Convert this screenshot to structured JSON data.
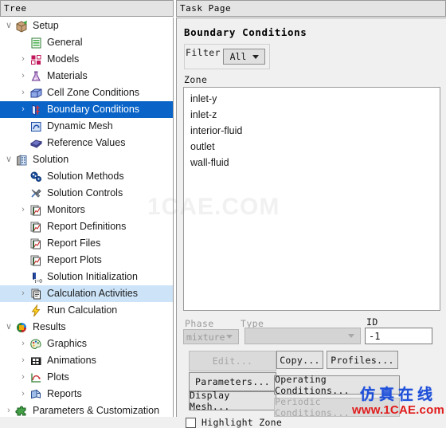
{
  "panels": {
    "tree_title": "Tree",
    "task_title": "Task Page"
  },
  "tree": {
    "items": [
      {
        "label": "Setup",
        "level": 0,
        "twisty": "∨",
        "icon": "setup-box-icon",
        "state": "normal"
      },
      {
        "label": "General",
        "level": 1,
        "twisty": "",
        "icon": "general-list-icon",
        "state": "normal"
      },
      {
        "label": "Models",
        "level": 1,
        "twisty": "›",
        "icon": "models-grid-icon",
        "state": "normal"
      },
      {
        "label": "Materials",
        "level": 1,
        "twisty": "›",
        "icon": "materials-flask-icon",
        "state": "normal"
      },
      {
        "label": "Cell Zone Conditions",
        "level": 1,
        "twisty": "›",
        "icon": "cell-zone-cube-icon",
        "state": "normal"
      },
      {
        "label": "Boundary Conditions",
        "level": 1,
        "twisty": "›",
        "icon": "boundary-conditions-icon",
        "state": "selected"
      },
      {
        "label": "Dynamic Mesh",
        "level": 1,
        "twisty": "",
        "icon": "dynamic-mesh-icon",
        "state": "normal"
      },
      {
        "label": "Reference Values",
        "level": 1,
        "twisty": "",
        "icon": "reference-values-icon",
        "state": "normal"
      },
      {
        "label": "Solution",
        "level": 0,
        "twisty": "∨",
        "icon": "solution-box-icon",
        "state": "normal"
      },
      {
        "label": "Solution Methods",
        "level": 1,
        "twisty": "",
        "icon": "solution-methods-icon",
        "state": "normal"
      },
      {
        "label": "Solution Controls",
        "level": 1,
        "twisty": "",
        "icon": "solution-controls-icon",
        "state": "normal"
      },
      {
        "label": "Monitors",
        "level": 1,
        "twisty": "›",
        "icon": "monitors-chart-icon",
        "state": "normal"
      },
      {
        "label": "Report Definitions",
        "level": 1,
        "twisty": "",
        "icon": "report-chart-icon",
        "state": "normal"
      },
      {
        "label": "Report Files",
        "level": 1,
        "twisty": "",
        "icon": "report-chart-icon",
        "state": "normal"
      },
      {
        "label": "Report Plots",
        "level": 1,
        "twisty": "",
        "icon": "report-chart-icon",
        "state": "normal"
      },
      {
        "label": "Solution Initialization",
        "level": 1,
        "twisty": "",
        "icon": "initialization-t0-icon",
        "state": "normal"
      },
      {
        "label": "Calculation Activities",
        "level": 1,
        "twisty": "›",
        "icon": "calculation-activities-icon",
        "state": "highlight"
      },
      {
        "label": "Run Calculation",
        "level": 1,
        "twisty": "",
        "icon": "run-calculation-bolt-icon",
        "state": "normal"
      },
      {
        "label": "Results",
        "level": 0,
        "twisty": "∨",
        "icon": "results-cube-icon",
        "state": "normal"
      },
      {
        "label": "Graphics",
        "level": 1,
        "twisty": "›",
        "icon": "graphics-palette-icon",
        "state": "normal"
      },
      {
        "label": "Animations",
        "level": 1,
        "twisty": "›",
        "icon": "animations-film-icon",
        "state": "normal"
      },
      {
        "label": "Plots",
        "level": 1,
        "twisty": "›",
        "icon": "plots-curve-icon",
        "state": "normal"
      },
      {
        "label": "Reports",
        "level": 1,
        "twisty": "›",
        "icon": "reports-icon",
        "state": "normal"
      },
      {
        "label": "Parameters & Customization",
        "level": 0,
        "twisty": "›",
        "icon": "parameters-puzzle-icon",
        "state": "normal"
      }
    ]
  },
  "task": {
    "title": "Boundary Conditions",
    "filter": {
      "label": "Filter",
      "value": "All",
      "options": [
        "All"
      ]
    },
    "zone": {
      "label": "Zone",
      "items": [
        "inlet-y",
        "inlet-z",
        "interior-fluid",
        "outlet",
        "wall-fluid"
      ]
    },
    "phase": {
      "label": "Phase",
      "value": "mixture",
      "options": [
        "mixture"
      ]
    },
    "type": {
      "label": "Type",
      "value": "",
      "options": []
    },
    "id": {
      "label": "ID",
      "value": "-1"
    },
    "buttons": {
      "edit": "Edit...",
      "parameters": "Parameters...",
      "display_mesh": "Display Mesh...",
      "copy": "Copy...",
      "profiles": "Profiles...",
      "operating_conditions": "Operating Conditions...",
      "periodic_conditions": "Periodic Conditions..."
    },
    "highlight_zone": {
      "label": "Highlight Zone",
      "checked": false
    }
  },
  "watermarks": {
    "center": "1CAE.COM",
    "brand_cn": "仿真在线",
    "brand_url": "www.1CAE.com"
  },
  "colors": {
    "selection_dark": "#0a64c8",
    "selection_light": "#cde3f7",
    "panel_bg": "#f0f0f0",
    "header_bg": "#e4e4e4",
    "watermark_blue": "#1f4fd8",
    "watermark_red": "#e01b1b"
  }
}
